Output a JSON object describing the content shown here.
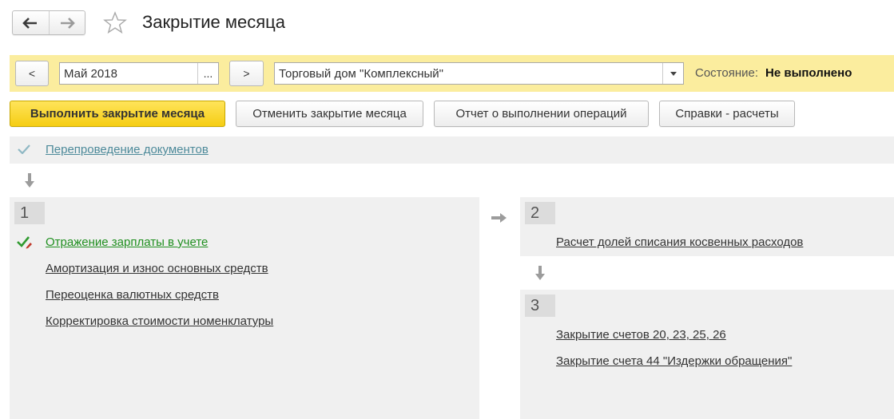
{
  "header": {
    "back_icon": "arrow-left-icon",
    "forward_icon": "arrow-right-icon",
    "favorite_icon": "star-icon",
    "title": "Закрытие месяца"
  },
  "filter": {
    "prev_label": "<",
    "period_value": "Май 2018",
    "period_choose_label": "...",
    "next_label": ">",
    "organization_value": "Торговый дом \"Комплексный\"",
    "state_label": "Состояние:",
    "state_value": "Не выполнено"
  },
  "actions": {
    "execute_label": "Выполнить закрытие месяца",
    "cancel_label": "Отменить закрытие месяца",
    "report_label": "Отчет о выполнении операций",
    "references_label": "Справки - расчеты"
  },
  "reposting": {
    "label": "Перепроведение документов",
    "status_icon": "check-icon"
  },
  "stages": [
    {
      "number": "1",
      "operations": [
        {
          "label": "Отражение зарплаты в учете",
          "status_icon": "check-edit-icon"
        },
        {
          "label": "Амортизация и износ основных средств"
        },
        {
          "label": "Переоценка валютных средств"
        },
        {
          "label": "Корректировка стоимости номенклатуры"
        }
      ]
    },
    {
      "number": "2",
      "operations": [
        {
          "label": "Расчет долей списания косвенных расходов"
        }
      ]
    },
    {
      "number": "3",
      "operations": [
        {
          "label": "Закрытие счетов 20, 23, 25, 26"
        },
        {
          "label": "Закрытие счета 44 \"Издержки обращения\""
        }
      ]
    }
  ],
  "colors": {
    "filter_bar_bg": "#fbed9e",
    "primary_button": "#f5cd14",
    "panel_bg": "#f0f0f0",
    "done_link": "#1f8f1f",
    "reposting_link": "#4d8a9a"
  }
}
